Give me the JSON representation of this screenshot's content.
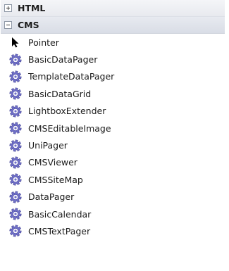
{
  "toolbox": {
    "sections": [
      {
        "label": "HTML",
        "expanded": false,
        "toggle_icon": "plus-icon"
      },
      {
        "label": "CMS",
        "expanded": true,
        "toggle_icon": "minus-icon"
      }
    ],
    "cms_items": [
      {
        "label": "Pointer",
        "icon": "pointer-arrow-icon"
      },
      {
        "label": "BasicDataPager",
        "icon": "gear-component-icon"
      },
      {
        "label": "TemplateDataPager",
        "icon": "gear-component-icon"
      },
      {
        "label": "BasicDataGrid",
        "icon": "gear-component-icon"
      },
      {
        "label": "LightboxExtender",
        "icon": "gear-component-icon"
      },
      {
        "label": "CMSEditableImage",
        "icon": "gear-component-icon"
      },
      {
        "label": "UniPager",
        "icon": "gear-component-icon"
      },
      {
        "label": "CMSViewer",
        "icon": "gear-component-icon"
      },
      {
        "label": "CMSSiteMap",
        "icon": "gear-component-icon"
      },
      {
        "label": "DataPager",
        "icon": "gear-component-icon"
      },
      {
        "label": "BasicCalendar",
        "icon": "gear-component-icon"
      },
      {
        "label": "CMSTextPager",
        "icon": "gear-component-icon"
      }
    ]
  },
  "colors": {
    "gear_fill": "#6f6fc8",
    "gear_center": "#ffffff",
    "pointer": "#000000"
  }
}
